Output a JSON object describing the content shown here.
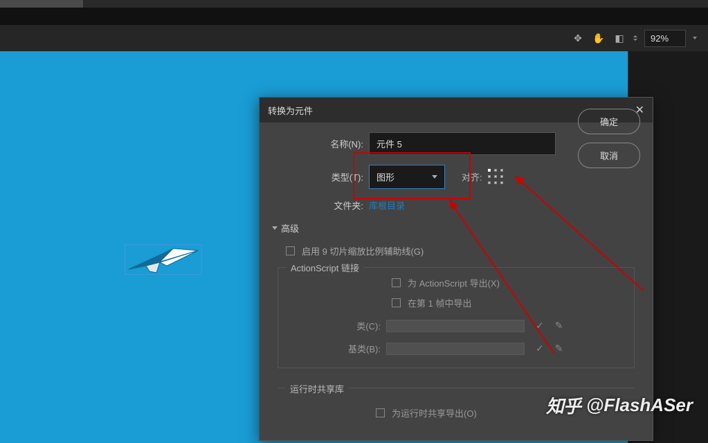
{
  "toolbar": {
    "zoom": "92%"
  },
  "dialog": {
    "title": "转换为元件",
    "name_label": "名称(N):",
    "name_value": "元件 5",
    "type_label": "类型(T):",
    "type_value": "图形",
    "align_label": "对齐:",
    "folder_label": "文件夹:",
    "folder_value": "库根目录",
    "ok": "确定",
    "cancel": "取消",
    "advanced": "高级",
    "enable_guides": "启用 9 切片缩放比例辅助线(G)",
    "as_linkage": "ActionScript 链接",
    "export_as": "为 ActionScript 导出(X)",
    "export_frame1": "在第 1 帧中导出",
    "class_label": "类(C):",
    "base_class_label": "基类(B):",
    "runtime_share": "运行时共享库",
    "export_runtime": "为运行时共享导出(O)"
  },
  "watermark": {
    "brand": "知乎",
    "handle": "@FlashASer"
  }
}
